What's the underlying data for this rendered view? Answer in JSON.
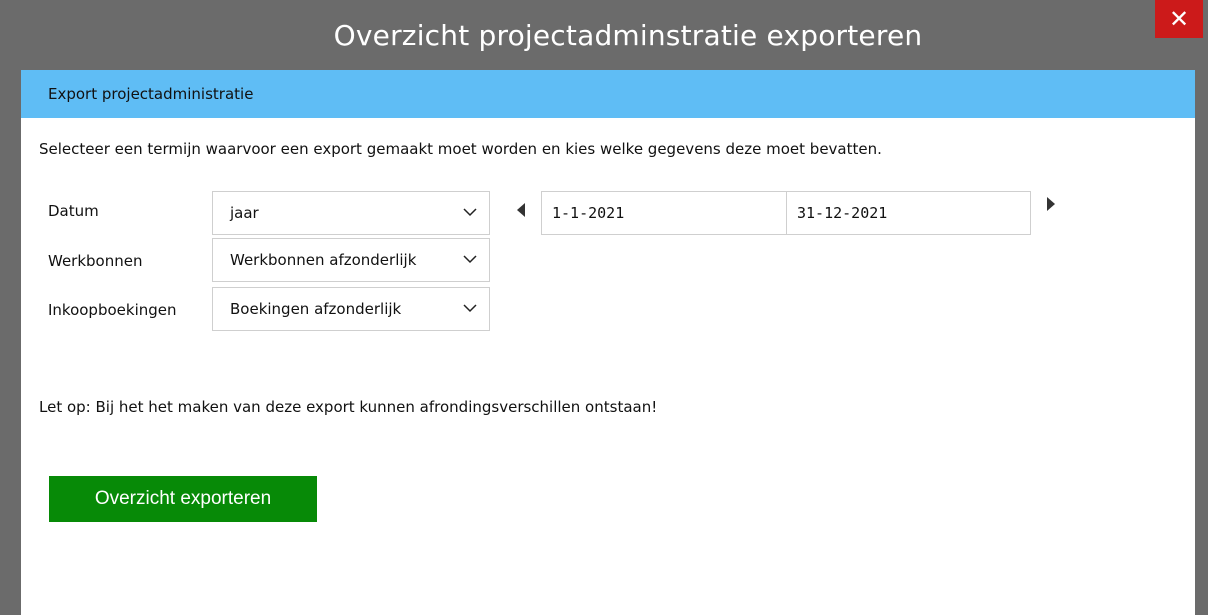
{
  "window": {
    "title": "Overzicht projectadminstratie exporteren",
    "close_label": "✕"
  },
  "section": {
    "header": "Export projectadministratie",
    "intro": "Selecteer een termijn waarvoor een export gemaakt moet worden en kies welke gegevens deze moet bevatten."
  },
  "form": {
    "datum": {
      "label": "Datum",
      "value": "jaar"
    },
    "werkbonnen": {
      "label": "Werkbonnen",
      "value": "Werkbonnen afzonderlijk"
    },
    "inkoopboekingen": {
      "label": "Inkoopboekingen",
      "value": "Boekingen afzonderlijk"
    },
    "date_from": "1-1-2021",
    "date_to": "31-12-2021"
  },
  "note": "Let op: Bij het het maken van deze export kunnen afrondingsverschillen ontstaan!",
  "actions": {
    "export_label": "Overzicht exporteren"
  },
  "colors": {
    "header_bg": "#5fbdf5",
    "button_bg": "#078a07",
    "close_bg": "#cc1a1a",
    "frame_bg": "#6b6b6b"
  }
}
